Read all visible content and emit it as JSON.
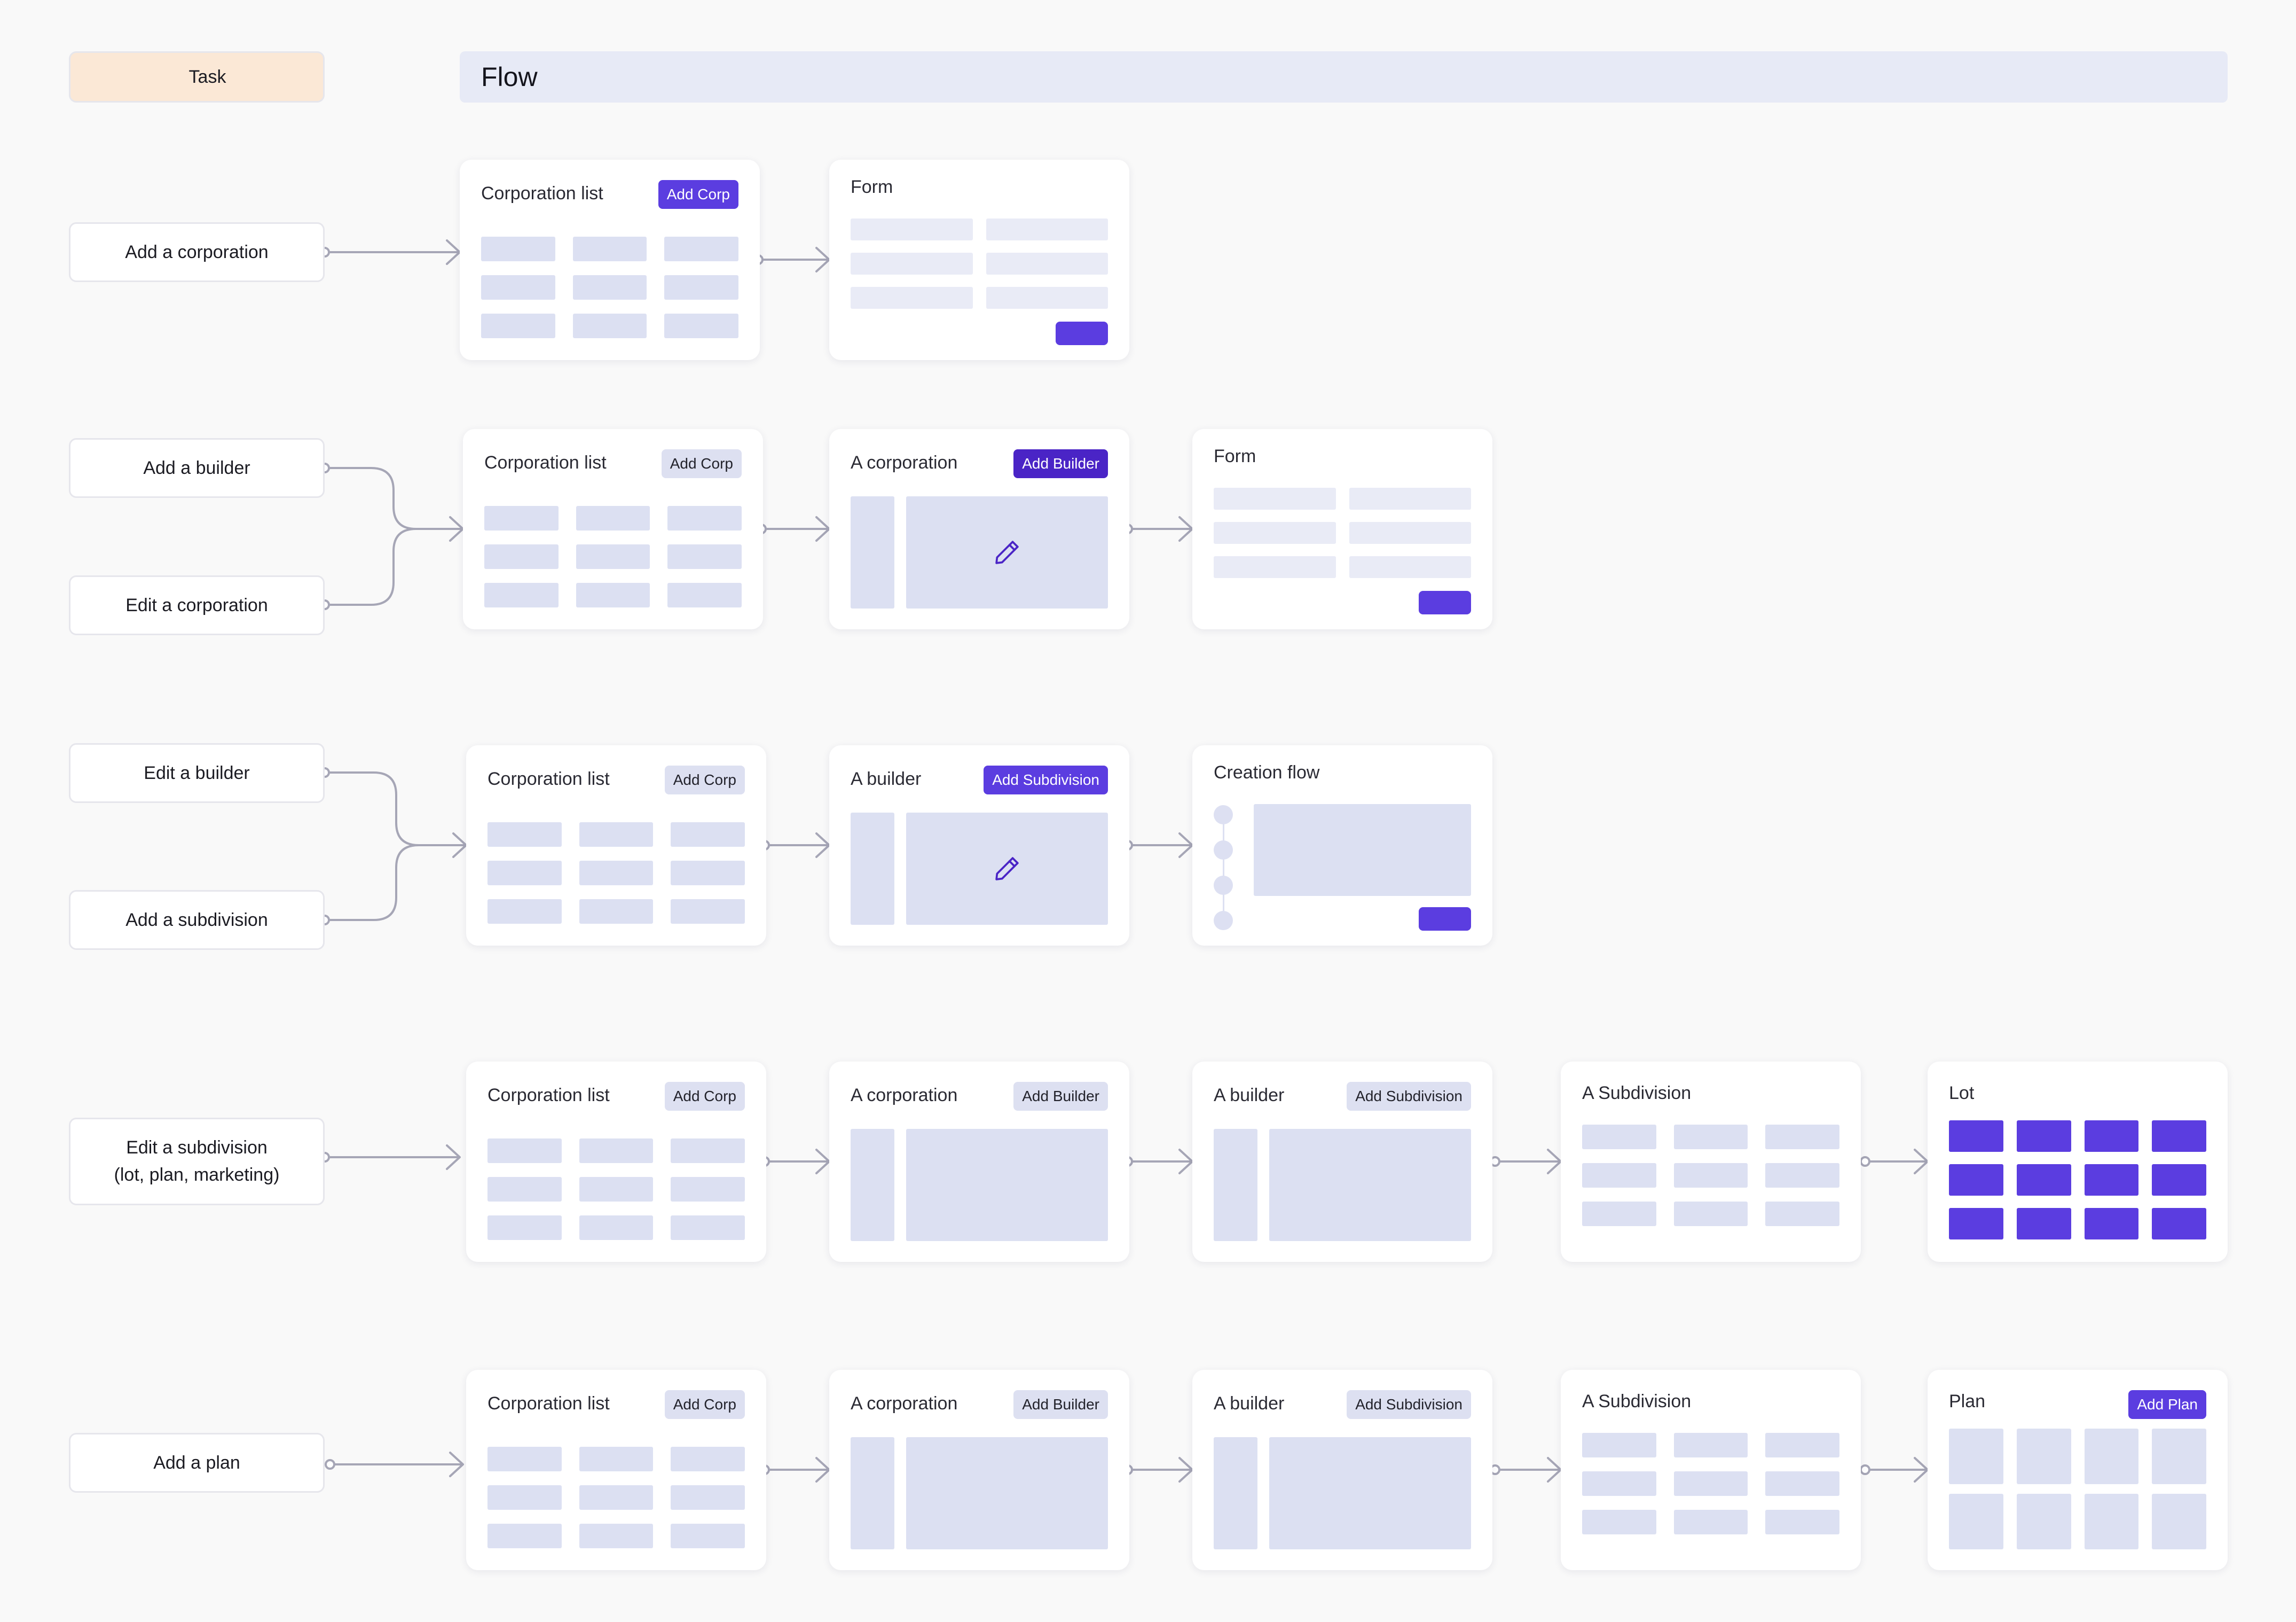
{
  "headers": {
    "task": "Task",
    "flow": "Flow"
  },
  "tasks": {
    "add_corporation": "Add a corporation",
    "add_builder": "Add a builder",
    "edit_corporation": "Edit a corporation",
    "edit_builder": "Edit a builder",
    "add_subdivision": "Add a subdivision",
    "edit_subdivision_line1": "Edit a subdivision",
    "edit_subdivision_line2": "(lot, plan, marketing)",
    "add_plan": "Add a plan"
  },
  "screens": {
    "corporation_list": "Corporation list",
    "form": "Form",
    "a_corporation": "A corporation",
    "a_builder": "A builder",
    "creation_flow": "Creation flow",
    "a_subdivision": "A Subdivision",
    "lot": "Lot",
    "plan": "Plan"
  },
  "buttons": {
    "add_corp": "Add Corp",
    "add_builder": "Add Builder",
    "add_subdivision": "Add Subdivision",
    "add_plan": "Add Plan"
  },
  "colors": {
    "accent": "#5b3de0",
    "accent_dark": "#4a24c6",
    "placeholder": "#dce0f2",
    "connector": "#a6a6b6",
    "task_header": "#fbe8d6",
    "flow_header": "#e7eaf6"
  },
  "icons": {
    "edit": "pencil-icon"
  }
}
